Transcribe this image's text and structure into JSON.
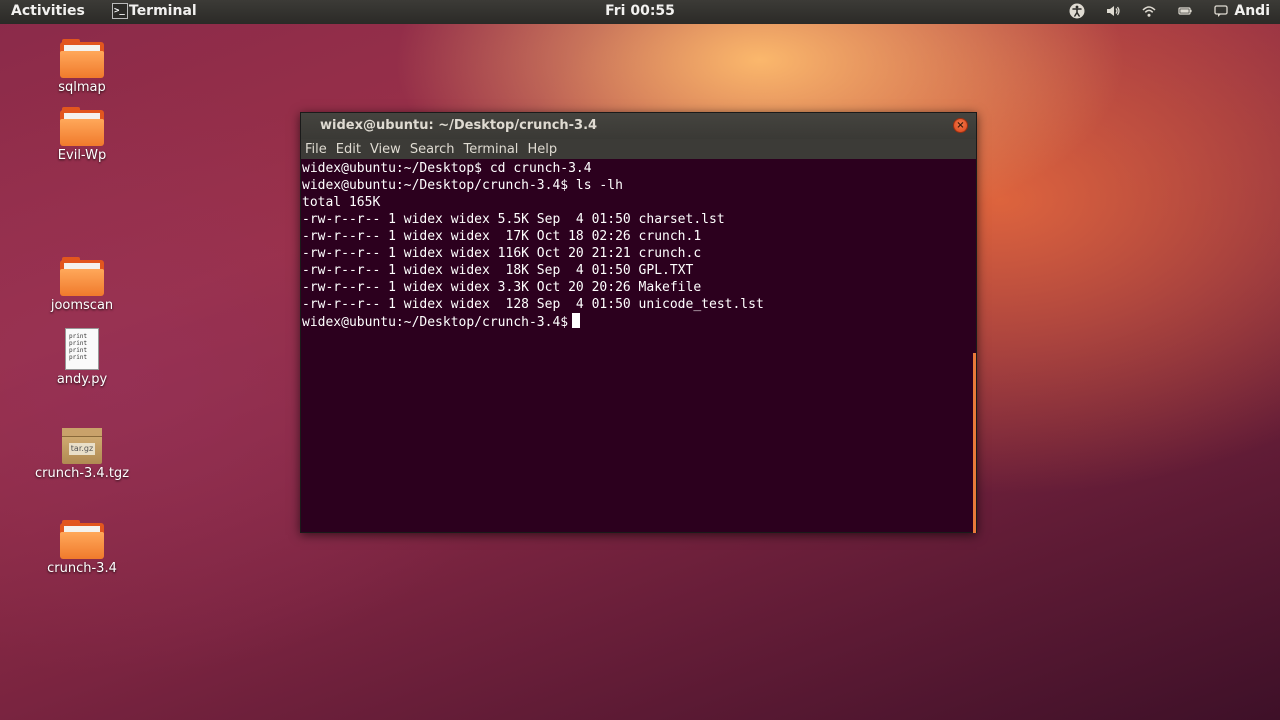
{
  "top_panel": {
    "activities": "Activities",
    "app_name": "Terminal",
    "clock": "Fri 00:55",
    "user": "Andi",
    "icons": [
      "accessibility-icon",
      "volume-icon",
      "wifi-icon",
      "battery-icon",
      "chat-icon"
    ]
  },
  "desktop": {
    "icons": [
      {
        "label": "sqlmap",
        "type": "folder"
      },
      {
        "label": "Evil-Wp",
        "type": "folder"
      },
      {
        "label": "joomscan",
        "type": "folder"
      },
      {
        "label": "andy.py",
        "type": "python-file",
        "preview": "print\nprint\nprint\nprint"
      },
      {
        "label": "crunch-3.4.tgz",
        "type": "archive",
        "badge": "tar.gz"
      },
      {
        "label": "crunch-3.4",
        "type": "folder"
      }
    ]
  },
  "terminal": {
    "title": "widex@ubuntu: ~/Desktop/crunch-3.4",
    "menu": [
      "File",
      "Edit",
      "View",
      "Search",
      "Terminal",
      "Help"
    ],
    "lines": [
      "widex@ubuntu:~/Desktop$ cd crunch-3.4",
      "widex@ubuntu:~/Desktop/crunch-3.4$ ls -lh",
      "total 165K",
      "-rw-r--r-- 1 widex widex 5.5K Sep  4 01:50 charset.lst",
      "-rw-r--r-- 1 widex widex  17K Oct 18 02:26 crunch.1",
      "-rw-r--r-- 1 widex widex 116K Oct 20 21:21 crunch.c",
      "-rw-r--r-- 1 widex widex  18K Sep  4 01:50 GPL.TXT",
      "-rw-r--r-- 1 widex widex 3.3K Oct 20 20:26 Makefile",
      "-rw-r--r-- 1 widex widex  128 Sep  4 01:50 unicode_test.lst"
    ],
    "prompt": "widex@ubuntu:~/Desktop/crunch-3.4$",
    "colors": {
      "background": "#2c001e",
      "text": "#ffffff",
      "scrollbar": "#e87a3a"
    }
  }
}
